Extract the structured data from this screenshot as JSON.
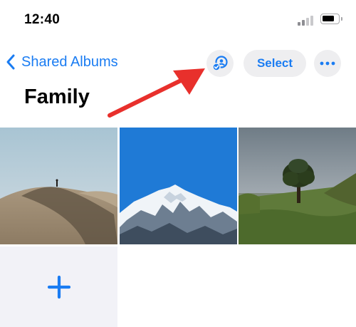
{
  "status_bar": {
    "time": "12:40"
  },
  "nav": {
    "back_label": "Shared Albums",
    "select_label": "Select"
  },
  "album": {
    "title": "Family"
  },
  "photos": [
    {
      "name": "desert-dune-photo"
    },
    {
      "name": "snowy-mountain-photo"
    },
    {
      "name": "tree-landscape-photo"
    }
  ],
  "colors": {
    "accent": "#1a7cf2",
    "annotation_arrow": "#e8302c",
    "button_bg": "#eeeef0"
  },
  "icons": [
    "chevron-left-icon",
    "activity-icon",
    "ellipsis-icon",
    "plus-icon",
    "cellular-signal-icon",
    "battery-icon"
  ]
}
